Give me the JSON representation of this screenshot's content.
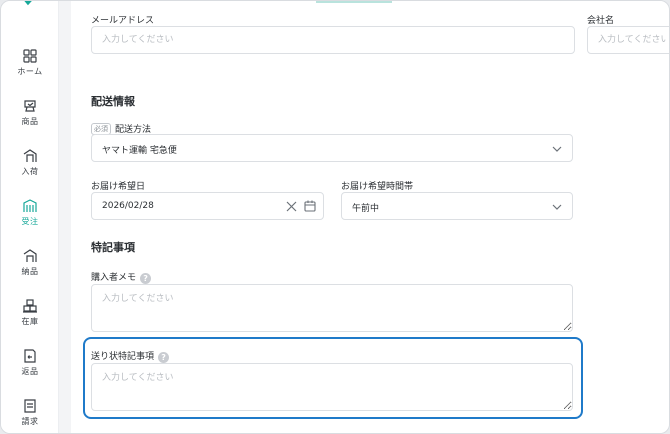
{
  "nav": {
    "items": [
      {
        "id": "home",
        "label": "ホーム",
        "icon": "grid-icon"
      },
      {
        "id": "products",
        "label": "商品",
        "icon": "product-box-icon"
      },
      {
        "id": "inbound",
        "label": "入荷",
        "icon": "inbound-icon"
      },
      {
        "id": "orders",
        "label": "受注",
        "icon": "order-icon",
        "active": true
      },
      {
        "id": "delivery",
        "label": "納品",
        "icon": "delivery-icon"
      },
      {
        "id": "stock",
        "label": "在庫",
        "icon": "stock-icon"
      },
      {
        "id": "returns",
        "label": "返品",
        "icon": "return-icon"
      },
      {
        "id": "billing",
        "label": "請求",
        "icon": "invoice-icon"
      }
    ],
    "accent_color": "#17a899"
  },
  "form": {
    "email": {
      "label": "メールアドレス",
      "placeholder": "入力してください"
    },
    "company": {
      "label": "会社名",
      "placeholder": "入力してください"
    },
    "shipping_section": "配送情報",
    "shipping_method": {
      "required_badge": "必須",
      "label": "配送方法",
      "value": "ヤマト運輸 宅急便"
    },
    "delivery_date": {
      "label": "お届け希望日",
      "value": "2026/02/28"
    },
    "delivery_time": {
      "label": "お届け希望時間帯",
      "value": "午前中"
    },
    "notes_section": "特記事項",
    "buyer_memo": {
      "label": "購入者メモ",
      "placeholder": "入力してください"
    },
    "invoice_notes": {
      "label": "送り状特記事項",
      "placeholder": "入力してください"
    },
    "help_glyph": "?"
  },
  "highlight_color": "#1f7ac9"
}
